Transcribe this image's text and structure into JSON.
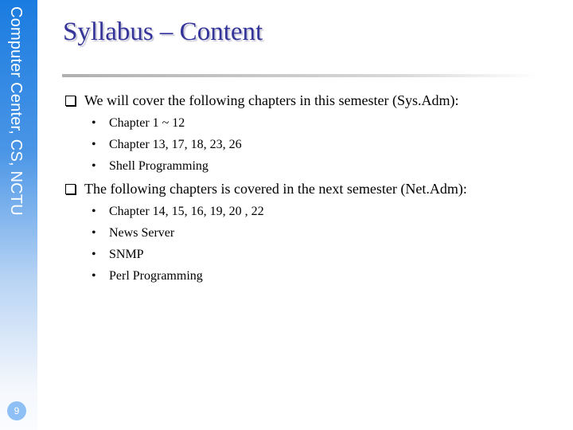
{
  "sidebar": {
    "text": "Computer Center, CS, NCTU",
    "page_number": "9"
  },
  "title": "Syllabus – Content",
  "sections": [
    {
      "text": "We will cover the following chapters in this semester (Sys.Adm):",
      "items": [
        "Chapter 1 ~ 12",
        "Chapter 13, 17, 18, 23, 26",
        "Shell Programming"
      ]
    },
    {
      "text": "The following chapters is covered in the next semester (Net.Adm):",
      "items": [
        "Chapter 14, 15, 16, 19, 20 , 22",
        "News Server",
        "SNMP",
        "Perl Programming"
      ]
    }
  ],
  "colors": {
    "title": "#333399",
    "sidebar_top": "#1a7ce0",
    "page_badge": "#8fc0f5"
  }
}
